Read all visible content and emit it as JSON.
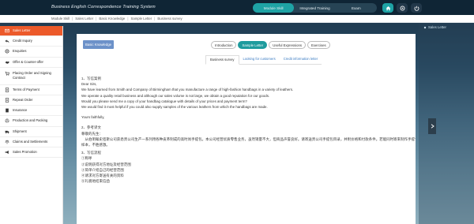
{
  "app": {
    "title": "Business English Correspondence Training System"
  },
  "modes": [
    {
      "label": "Module Skill",
      "active": true
    },
    {
      "label": "Integrated Training",
      "active": false
    },
    {
      "label": "Exam",
      "active": false
    }
  ],
  "top_icons": [
    "home-icon",
    "settings-icon",
    "power-icon"
  ],
  "breadcrumb": [
    "Module Skill",
    "Sales Letter",
    "Basic Knowledge",
    "Sample Letter",
    "Business survey"
  ],
  "sidebar": {
    "items": [
      {
        "label": "Sales Letter",
        "icon": "mail-icon",
        "active": true
      },
      {
        "label": "Credit Inquiry",
        "icon": "reply-icon"
      },
      {
        "label": "Enquiries",
        "icon": "settings-icon"
      },
      {
        "label": "Offer & Counter-offer",
        "icon": "handshake-icon"
      },
      {
        "label": "Placing Order and Signing Contract",
        "icon": "cart-icon"
      },
      {
        "label": "Terms of Payment",
        "icon": "document-icon"
      },
      {
        "label": "Repeat Order",
        "icon": "document-icon"
      },
      {
        "label": "Insurance",
        "icon": "document-icon"
      },
      {
        "label": "Production and Packing",
        "icon": "gear-icon"
      },
      {
        "label": "Shipment",
        "icon": "truck-icon"
      },
      {
        "label": "Claims and Settlements",
        "icon": "scale-icon"
      },
      {
        "label": "Sales Promotion",
        "icon": "megaphone-icon"
      }
    ]
  },
  "content": {
    "knowledge_button": "Basic Knowledge",
    "tabs": [
      {
        "label": "Introduction",
        "active": false
      },
      {
        "label": "Sample Letter",
        "active": true
      },
      {
        "label": "Useful Expressions",
        "active": false
      },
      {
        "label": "Exercises",
        "active": false
      }
    ],
    "subtabs": [
      {
        "label": "Business survey",
        "active": true
      },
      {
        "label": "Looking for customers",
        "active": false
      },
      {
        "label": "Credit information letter",
        "active": false
      }
    ],
    "letter": {
      "heading": "1、写信案例",
      "greeting": "Dear Sirs,",
      "lines": [
        "We have learned from Smith and Company of Birmingham that you manufacture a range of high-fashion handbags in a variety of leathers.",
        "We operate a quality retail business and although our sales volume is not large, we obtain a good reputation for our goods.",
        "Would you please send me a copy of your handbag catalogue with details of your prices and payment term?",
        "We would find it most helpful if you could also supply samples of the various leathers from which the handbags are made."
      ],
      "closing": "Yours faithfully,"
    },
    "translation": {
      "heading": "2、参考译文",
      "greeting": "尊敬的先生：",
      "line1": "　从伯明翰史密斯公司获悉贵公司生产一系列用各种皮革制成的高时尚手提包。本公司经营优质零售业务，虽然销量不大，但商品声誉良好。请寄送贵公司手提包目录，并附价格和付款条件。若能同时寄来制作手提包所用的各种皮革",
      "line2": "样本，不胜感激。"
    },
    "steps": {
      "heading": "3、写信流程",
      "items": [
        "①称呼",
        "②说明获得对方地址及经营范围",
        "③简单介绍自己的经营范围",
        "④请求对方寄送有关的资料",
        "⑤礼貌地结束信函"
      ]
    }
  },
  "right_panel": {
    "label": "Sales Letter"
  },
  "colors": {
    "accent": "#1ea3a5",
    "sidebar_active": "#ec5a2a",
    "header": "#0f2535",
    "knowledge_btn": "#6c91c9"
  }
}
